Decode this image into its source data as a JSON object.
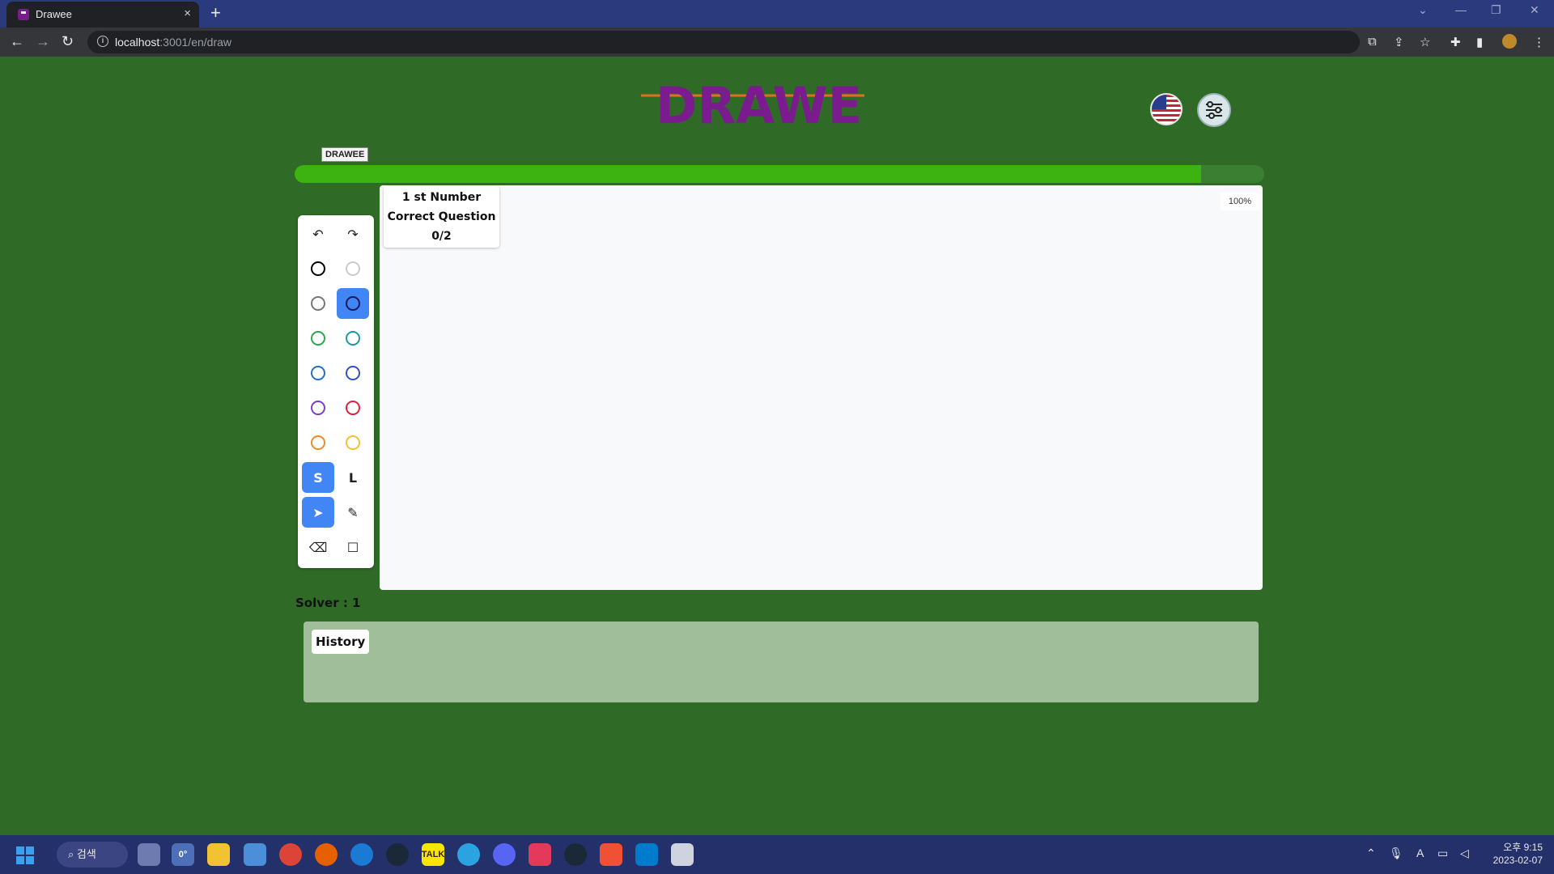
{
  "browser": {
    "tab_title": "Drawee",
    "tab_close": "×",
    "new_tab": "+",
    "url_host": "localhost",
    "url_rest": ":3001/en/draw"
  },
  "page": {
    "logo_text": "DRAWEE",
    "tag_label": "DRAWEE",
    "progress_fraction": 0.935,
    "question": {
      "line1": "1 st Number",
      "line2": "Correct Question",
      "line3": "0/2"
    },
    "zoom": "100%",
    "tools": {
      "size_small": "S",
      "size_large": "L"
    },
    "colors": {
      "black": "#000000",
      "lightgray": "#cccccc",
      "gray": "#777777",
      "darkblue": "#1a1a5e",
      "green": "#2aa84a",
      "teal": "#1a9aa0",
      "blue": "#2271c4",
      "indigo": "#3350c0",
      "purple": "#7b3fc4",
      "red": "#e0203a",
      "orange": "#f08a24",
      "yellow": "#f2c230",
      "accent": "#4285f4",
      "brand": "#7a1c8e"
    },
    "solver": "Solver : 1",
    "history_label": "History"
  },
  "taskbar": {
    "search": "검색",
    "weather": "0°",
    "time": "오후 9:15",
    "date": "2023-02-07",
    "ime": "A"
  }
}
